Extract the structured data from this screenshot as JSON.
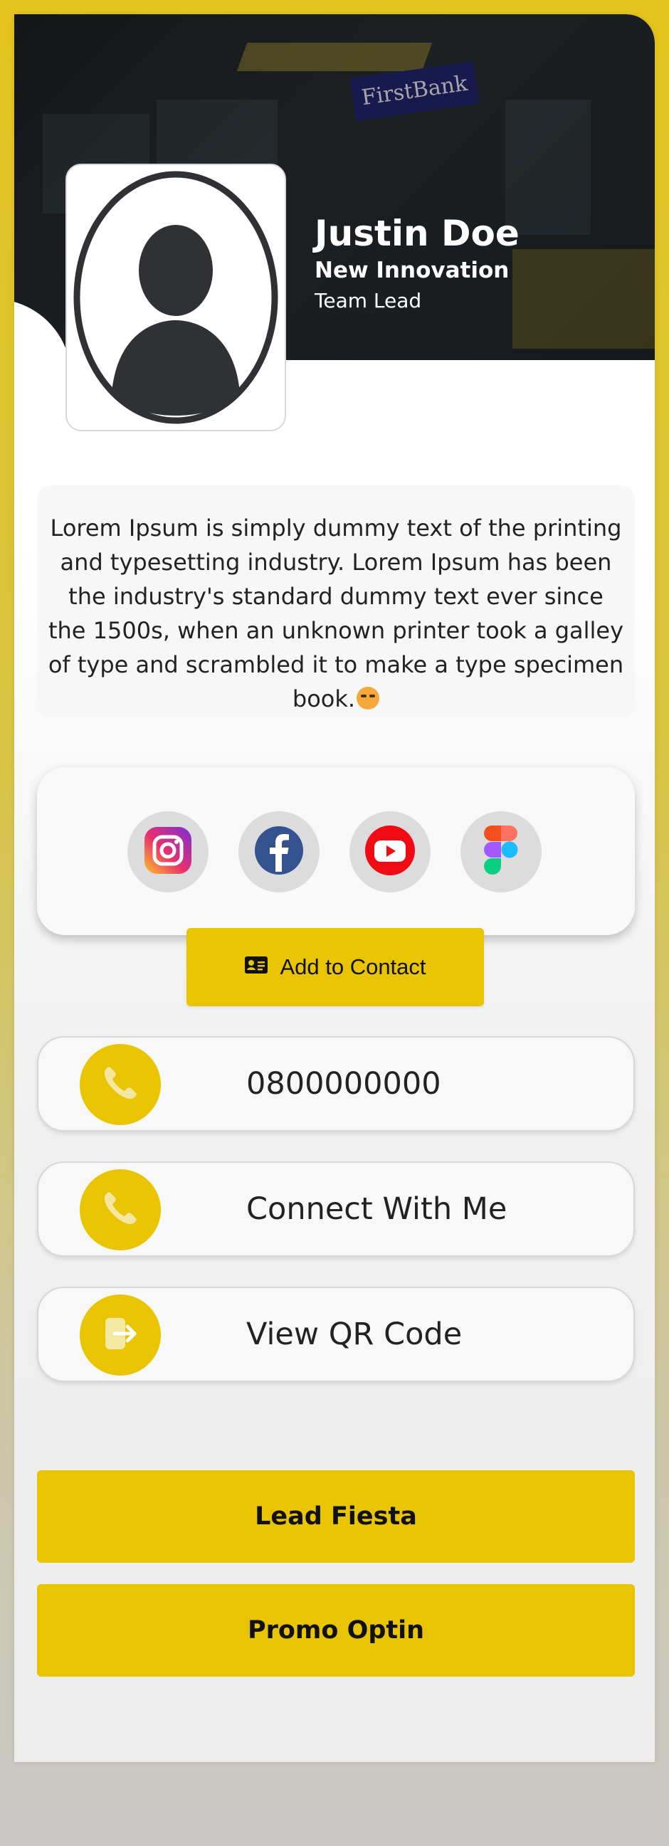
{
  "profile": {
    "name": "Justin Doe",
    "company": "New Innovation",
    "role": "Team Lead",
    "background_sign": "FirstBank"
  },
  "bio": {
    "text": "Lorem Ipsum is simply dummy text of the printing and typesetting industry. Lorem Ipsum has been the industry's standard dummy text ever since the 1500s, when an unknown printer took a galley of type and scrambled it to make a type specimen book."
  },
  "socials": [
    {
      "name": "Instagram",
      "icon": "instagram-icon"
    },
    {
      "name": "Facebook",
      "icon": "facebook-icon"
    },
    {
      "name": "YouTube",
      "icon": "youtube-icon"
    },
    {
      "name": "Figma",
      "icon": "figma-icon"
    }
  ],
  "add_contact": {
    "label": "Add to Contact",
    "icon": "contact-card-icon"
  },
  "actions": [
    {
      "label": "0800000000",
      "icon": "phone-icon"
    },
    {
      "label": "Connect With Me",
      "icon": "phone-icon"
    },
    {
      "label": "View QR Code",
      "icon": "sign-in-icon"
    }
  ],
  "buttons": {
    "lead_fiesta": "Lead Fiesta",
    "promo_optin": "Promo Optin"
  },
  "colors": {
    "accent": "#e9c400",
    "hero_dark": "#22272b",
    "text": "#222222"
  }
}
